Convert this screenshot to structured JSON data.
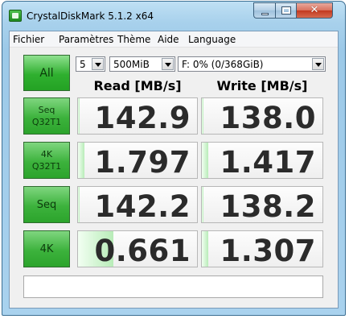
{
  "window": {
    "title": "CrystalDiskMark 5.1.2 x64"
  },
  "menu": [
    "Fichier",
    "Paramètres",
    "Thème",
    "Aide",
    "Language"
  ],
  "controls": {
    "all_button": "All",
    "test_count": "5",
    "test_size": "500MiB",
    "drive": "F: 0% (0/368GiB)"
  },
  "columns": {
    "read": "Read [MB/s]",
    "write": "Write [MB/s]"
  },
  "rows": [
    {
      "label_line1": "Seq",
      "label_line2": "Q32T1",
      "read": "142.9",
      "write": "138.0",
      "read_fill": 0.013,
      "write_fill": 0.013
    },
    {
      "label_line1": "4K",
      "label_line2": "Q32T1",
      "read": "1.797",
      "write": "1.417",
      "read_fill": 0.055,
      "write_fill": 0.05
    },
    {
      "label_line1": "Seq",
      "label_line2": "",
      "read": "142.2",
      "write": "138.2",
      "read_fill": 0.013,
      "write_fill": 0.013
    },
    {
      "label_line1": "4K",
      "label_line2": "",
      "read": "0.661",
      "write": "1.307",
      "read_fill": 0.3,
      "write_fill": 0.05
    }
  ],
  "status": {
    "text": ""
  },
  "colors": {
    "accent_green": "#2fb02f",
    "bar_green": "#b8ecb8"
  }
}
